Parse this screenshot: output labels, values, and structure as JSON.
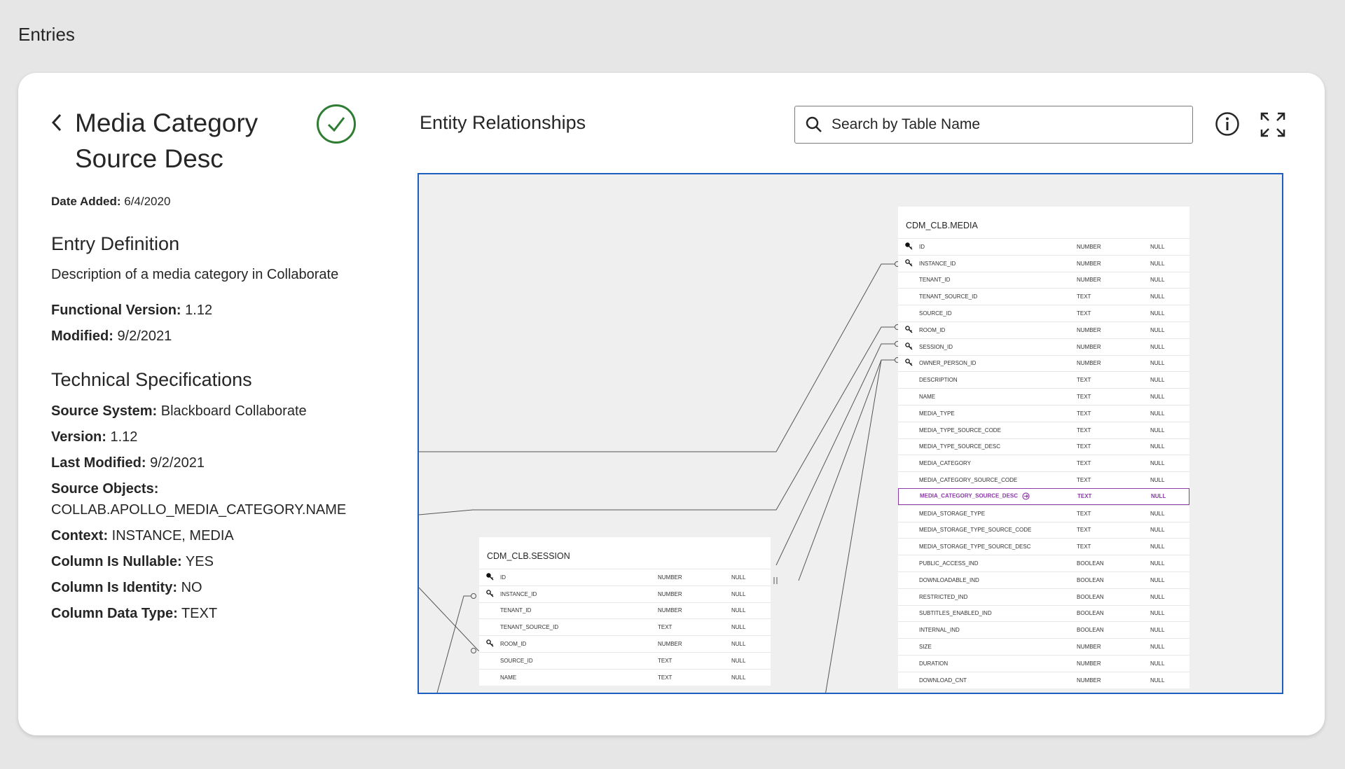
{
  "page": {
    "heading": "Entries"
  },
  "entry": {
    "title": "Media Category Source Desc",
    "date_added_label": "Date Added:",
    "date_added": "6/4/2020",
    "definition_heading": "Entry Definition",
    "definition": "Description of a media category in Collaborate",
    "functional_version_label": "Functional Version:",
    "functional_version": "1.12",
    "modified_label": "Modified:",
    "modified": "9/2/2021"
  },
  "tech": {
    "heading": "Technical Specifications",
    "source_system_label": "Source System:",
    "source_system": "Blackboard Collaborate",
    "version_label": "Version:",
    "version": "1.12",
    "last_modified_label": "Last Modified:",
    "last_modified": "9/2/2021",
    "source_objects_label": "Source Objects:",
    "source_objects": "COLLAB.APOLLO_MEDIA_CATEGORY.NAME",
    "context_label": "Context:",
    "context": "INSTANCE, MEDIA",
    "nullable_label": "Column Is Nullable:",
    "nullable": "YES",
    "identity_label": "Column Is Identity:",
    "identity": "NO",
    "data_type_label": "Column Data Type:",
    "data_type": "TEXT"
  },
  "er": {
    "title": "Entity Relationships",
    "search_placeholder": "Search by Table Name",
    "tables": [
      {
        "name": "CDM_CLB.MEDIA",
        "columns": [
          {
            "icon": "primary-key-icon",
            "name": "ID",
            "type": "NUMBER",
            "null": "NULL"
          },
          {
            "icon": "foreign-key-icon",
            "name": "INSTANCE_ID",
            "type": "NUMBER",
            "null": "NULL"
          },
          {
            "icon": "",
            "name": "TENANT_ID",
            "type": "NUMBER",
            "null": "NULL"
          },
          {
            "icon": "",
            "name": "TENANT_SOURCE_ID",
            "type": "TEXT",
            "null": "NULL"
          },
          {
            "icon": "",
            "name": "SOURCE_ID",
            "type": "TEXT",
            "null": "NULL"
          },
          {
            "icon": "foreign-key-icon",
            "name": "ROOM_ID",
            "type": "NUMBER",
            "null": "NULL"
          },
          {
            "icon": "foreign-key-icon",
            "name": "SESSION_ID",
            "type": "NUMBER",
            "null": "NULL"
          },
          {
            "icon": "foreign-key-icon",
            "name": "OWNER_PERSON_ID",
            "type": "NUMBER",
            "null": "NULL"
          },
          {
            "icon": "",
            "name": "DESCRIPTION",
            "type": "TEXT",
            "null": "NULL"
          },
          {
            "icon": "",
            "name": "NAME",
            "type": "TEXT",
            "null": "NULL"
          },
          {
            "icon": "",
            "name": "MEDIA_TYPE",
            "type": "TEXT",
            "null": "NULL"
          },
          {
            "icon": "",
            "name": "MEDIA_TYPE_SOURCE_CODE",
            "type": "TEXT",
            "null": "NULL"
          },
          {
            "icon": "",
            "name": "MEDIA_TYPE_SOURCE_DESC",
            "type": "TEXT",
            "null": "NULL"
          },
          {
            "icon": "",
            "name": "MEDIA_CATEGORY",
            "type": "TEXT",
            "null": "NULL"
          },
          {
            "icon": "",
            "name": "MEDIA_CATEGORY_SOURCE_CODE",
            "type": "TEXT",
            "null": "NULL"
          },
          {
            "icon": "",
            "name": "MEDIA_CATEGORY_SOURCE_DESC",
            "type": "TEXT",
            "null": "NULL",
            "highlight": true
          },
          {
            "icon": "",
            "name": "MEDIA_STORAGE_TYPE",
            "type": "TEXT",
            "null": "NULL"
          },
          {
            "icon": "",
            "name": "MEDIA_STORAGE_TYPE_SOURCE_CODE",
            "type": "TEXT",
            "null": "NULL"
          },
          {
            "icon": "",
            "name": "MEDIA_STORAGE_TYPE_SOURCE_DESC",
            "type": "TEXT",
            "null": "NULL"
          },
          {
            "icon": "",
            "name": "PUBLIC_ACCESS_IND",
            "type": "BOOLEAN",
            "null": "NULL"
          },
          {
            "icon": "",
            "name": "DOWNLOADABLE_IND",
            "type": "BOOLEAN",
            "null": "NULL"
          },
          {
            "icon": "",
            "name": "RESTRICTED_IND",
            "type": "BOOLEAN",
            "null": "NULL"
          },
          {
            "icon": "",
            "name": "SUBTITLES_ENABLED_IND",
            "type": "BOOLEAN",
            "null": "NULL"
          },
          {
            "icon": "",
            "name": "INTERNAL_IND",
            "type": "BOOLEAN",
            "null": "NULL"
          },
          {
            "icon": "",
            "name": "SIZE",
            "type": "NUMBER",
            "null": "NULL"
          },
          {
            "icon": "",
            "name": "DURATION",
            "type": "NUMBER",
            "null": "NULL"
          },
          {
            "icon": "",
            "name": "DOWNLOAD_CNT",
            "type": "NUMBER",
            "null": "NULL"
          }
        ]
      },
      {
        "name": "CDM_CLB.SESSION",
        "columns": [
          {
            "icon": "primary-key-icon",
            "name": "ID",
            "type": "NUMBER",
            "null": "NULL"
          },
          {
            "icon": "foreign-key-icon",
            "name": "INSTANCE_ID",
            "type": "NUMBER",
            "null": "NULL"
          },
          {
            "icon": "",
            "name": "TENANT_ID",
            "type": "NUMBER",
            "null": "NULL"
          },
          {
            "icon": "",
            "name": "TENANT_SOURCE_ID",
            "type": "TEXT",
            "null": "NULL"
          },
          {
            "icon": "foreign-key-icon",
            "name": "ROOM_ID",
            "type": "NUMBER",
            "null": "NULL"
          },
          {
            "icon": "",
            "name": "SOURCE_ID",
            "type": "TEXT",
            "null": "NULL"
          },
          {
            "icon": "",
            "name": "NAME",
            "type": "TEXT",
            "null": "NULL"
          }
        ]
      }
    ]
  }
}
